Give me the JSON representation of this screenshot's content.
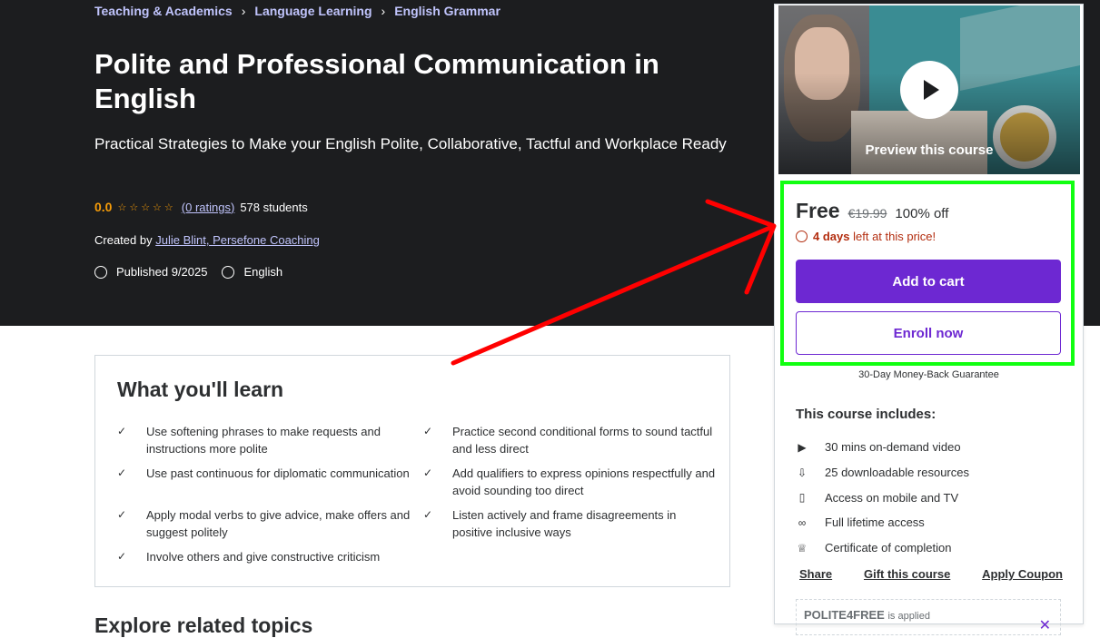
{
  "breadcrumb": {
    "items": [
      "Teaching & Academics",
      "Language Learning",
      "English Grammar"
    ],
    "separator": "›"
  },
  "course": {
    "title": "Polite and Professional Communication in English",
    "subtitle": "Practical Strategies to Make your English Polite, Collaborative, Tactful and Workplace Ready",
    "rating": "0.0",
    "stars": "☆☆☆☆☆",
    "ratings_link": "(0 ratings)",
    "students": "578 students",
    "created_by_label": "Created by",
    "instructors": "Julie Blint, Persefone Coaching",
    "published": "Published 9/2025",
    "language": "English"
  },
  "learn": {
    "title": "What you'll learn",
    "items": [
      "Use softening phrases to make requests and instructions more polite",
      "Practice second conditional forms to sound tactful and less direct",
      "Use past continuous for diplomatic communication",
      "Add qualifiers to express opinions respectfully and avoid sounding too direct",
      "Apply modal verbs to give advice, make offers and suggest politely",
      "Listen actively and frame disagreements in positive inclusive ways",
      "Involve others and give constructive criticism"
    ]
  },
  "next_section_heading": "Explore related topics",
  "sidebar": {
    "preview_label": "Preview this course",
    "price_now": "Free",
    "price_original": "€19.99",
    "discount": "100% off",
    "timer_bold": "4 days",
    "timer_rest": "left at this price!",
    "add_to_cart": "Add to cart",
    "enroll_now": "Enroll now",
    "guarantee": "30-Day Money-Back Guarantee",
    "includes_title": "This course includes:",
    "includes": [
      {
        "icon": "video-icon",
        "glyph": "▶",
        "label": "30 mins on-demand video"
      },
      {
        "icon": "file-download-icon",
        "glyph": "⇩",
        "label": "25 downloadable resources"
      },
      {
        "icon": "mobile-icon",
        "glyph": "▯",
        "label": "Access on mobile and TV"
      },
      {
        "icon": "infinity-icon",
        "glyph": "∞",
        "label": "Full lifetime access"
      },
      {
        "icon": "trophy-icon",
        "glyph": "♕",
        "label": "Certificate of completion"
      }
    ],
    "links": [
      "Share",
      "Gift this course",
      "Apply Coupon"
    ],
    "coupon_code": "POLITE4FREE",
    "coupon_status": "is applied"
  },
  "colors": {
    "hero_bg": "#1c1d1f",
    "accent_purple": "#6d28d2",
    "link_lavender": "#c0c4fc",
    "rating_orange": "#f69c08",
    "timer_red": "#b32d0f",
    "annotation_green": "#11ff11",
    "annotation_red": "#ff0000"
  }
}
